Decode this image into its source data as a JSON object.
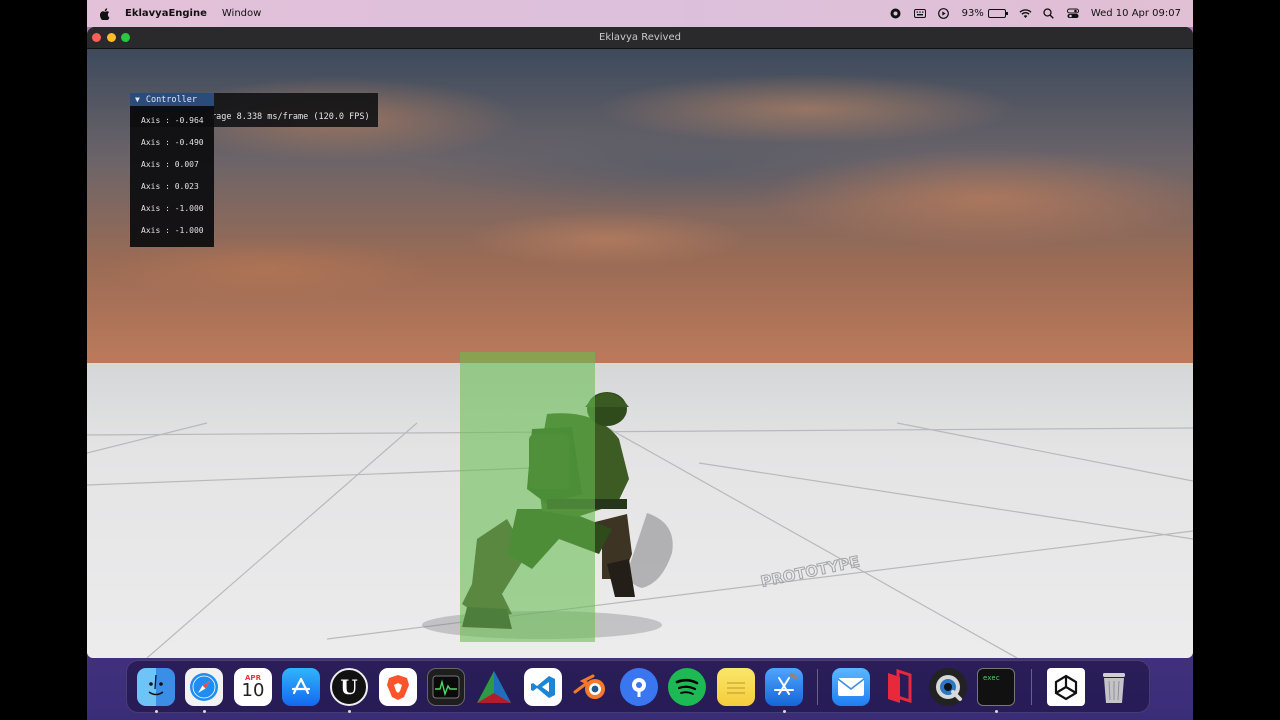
{
  "menubar": {
    "app_name": "EklavyaEngine",
    "menus": [
      "Window"
    ],
    "battery_percent": "93%",
    "battery_level": 0.93,
    "datetime": "Wed 10 Apr  09:07",
    "status_icons": [
      "screen-record-icon",
      "keyboard-icon",
      "play-icon",
      "wifi-icon",
      "search-icon",
      "control-center-icon"
    ]
  },
  "window": {
    "title": "Eklavya Revived"
  },
  "imgui": {
    "fps_text": "rage 8.338 ms/frame (120.0 FPS)",
    "controller": {
      "title": "Controller",
      "axes": [
        "Axis : -0.964",
        "Axis : -0.490",
        "Axis : 0.007",
        "Axis : 0.023",
        "Axis : -1.000",
        "Axis : -1.000"
      ]
    }
  },
  "scene": {
    "floor_text": "PROTOTYPE"
  },
  "dock": {
    "calendar_month": "APR",
    "calendar_day": "10",
    "terminal_text": "exec",
    "apps": [
      "finder-icon",
      "safari-icon",
      "calendar-icon",
      "app-store-icon",
      "unreal-engine-icon",
      "brave-icon",
      "activity-monitor-icon",
      "nsight-icon",
      "vscode-icon",
      "blender-icon",
      "signal-icon",
      "spotify-icon",
      "notes-icon",
      "xcode-icon",
      "mail-icon",
      "parallels-icon",
      "quicktime-icon",
      "terminal-icon",
      "unity-icon",
      "trash-icon"
    ]
  },
  "colors": {
    "collider": "#66be50",
    "imgui_header": "#2b4c7b"
  }
}
